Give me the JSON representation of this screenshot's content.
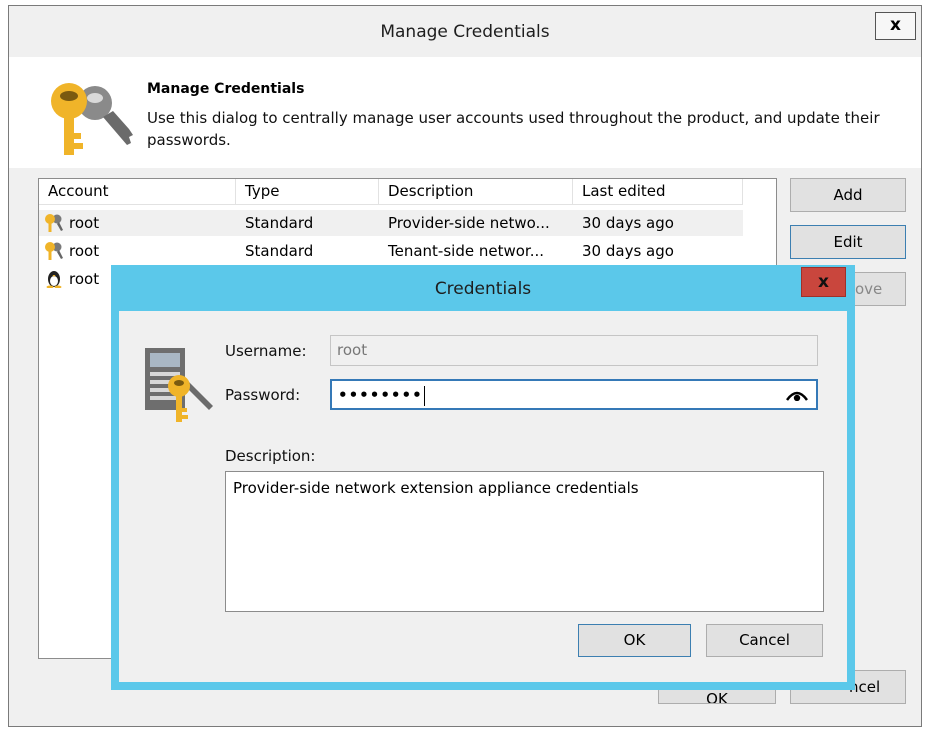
{
  "main": {
    "title": "Manage Credentials",
    "close_label": "x",
    "header_title": "Manage Credentials",
    "header_description": "Use this dialog to centrally manage user accounts used throughout the product, and update their passwords.",
    "columns": [
      "Account",
      "Type",
      "Description",
      "Last edited"
    ],
    "rows": [
      {
        "icon": "key-icon",
        "account": "root",
        "type": "Standard",
        "description": "Provider-side netwo...",
        "last_edited": "30 days ago"
      },
      {
        "icon": "key-icon",
        "account": "root",
        "type": "Standard",
        "description": "Tenant-side networ...",
        "last_edited": "30 days ago"
      },
      {
        "icon": "linux-penguin-icon",
        "account": "root",
        "type": "",
        "description": "",
        "last_edited": ""
      }
    ],
    "buttons": {
      "add": "Add",
      "edit": "Edit",
      "remove_partial": "ove",
      "ok_partial": "OK",
      "cancel_partial": "ncel"
    }
  },
  "dialog": {
    "title": "Credentials",
    "close_label": "x",
    "username_label": "Username:",
    "username_value": "root",
    "password_label": "Password:",
    "password_value": "••••••••",
    "description_label": "Description:",
    "description_value": "Provider-side network extension appliance credentials",
    "ok_label": "OK",
    "cancel_label": "Cancel",
    "accent": "#5bc8ea",
    "close_color": "#c9463d"
  }
}
